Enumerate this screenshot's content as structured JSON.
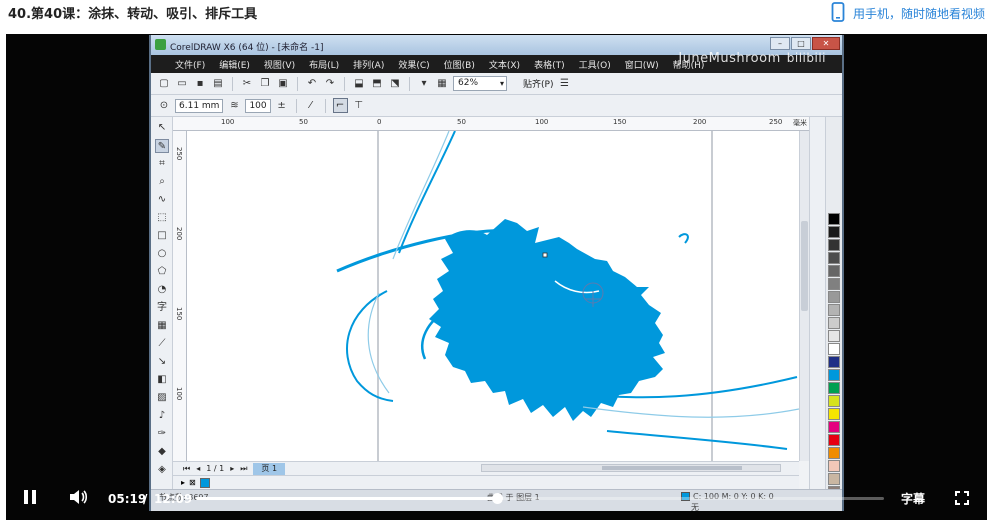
{
  "header": {
    "lesson_title": "40.第40课：涂抹、转动、吸引、排斥工具",
    "mobile_link": "用手机，随时随地看视频",
    "mobile_icon": "phone-icon"
  },
  "coreldraw": {
    "title": "CorelDRAW X6 (64 位) - [未命名 -1]",
    "menu": [
      "文件(F)",
      "编辑(E)",
      "视图(V)",
      "布局(L)",
      "排列(A)",
      "效果(C)",
      "位图(B)",
      "文本(X)",
      "表格(T)",
      "工具(O)",
      "窗口(W)",
      "帮助(H)"
    ],
    "watermark": "JuneMushroom",
    "watermark_brand": "bilibili",
    "zoom": "62%",
    "snap": "贴齐(P)",
    "nib_size": "6.11 mm",
    "pressure": "100",
    "ruler_top_ticks": [
      "100",
      "50",
      "0",
      "50",
      "100",
      "150",
      "200",
      "250",
      "毫米"
    ],
    "ruler_left_ticks": [
      "250",
      "200",
      "150",
      "100"
    ],
    "page_counter": "1 / 1",
    "page_tab": "页 1",
    "status_nodes": "节点数: 3697",
    "status_layer": "曲线 于 图层 1",
    "status_fill": "C: 100 M: 0 Y: 0 K: 0",
    "status_outline": "无",
    "fill_color": "#0098dc",
    "palette": [
      "#000000",
      "#1a1a1a",
      "#333333",
      "#4d4d4d",
      "#666666",
      "#808080",
      "#999999",
      "#b3b3b3",
      "#cccccc",
      "#e6e6e6",
      "#ffffff",
      "#1f2f86",
      "#0098dc",
      "#00a050",
      "#d7e21e",
      "#f5e500",
      "#e4007f",
      "#e60012",
      "#f08c00",
      "#f2c8b8",
      "#c9b6a2",
      "#8e7f7a",
      "#a7c2d8",
      "#8f8fc4"
    ]
  },
  "player": {
    "current_time": "05:19",
    "separator": "/",
    "total_time": "12:09",
    "progress_fraction": 0.437,
    "subtitle_label": "字幕",
    "play_state_icon": "pause-icon",
    "volume_icon": "volume-icon",
    "fullscreen_icon": "fullscreen-icon"
  }
}
